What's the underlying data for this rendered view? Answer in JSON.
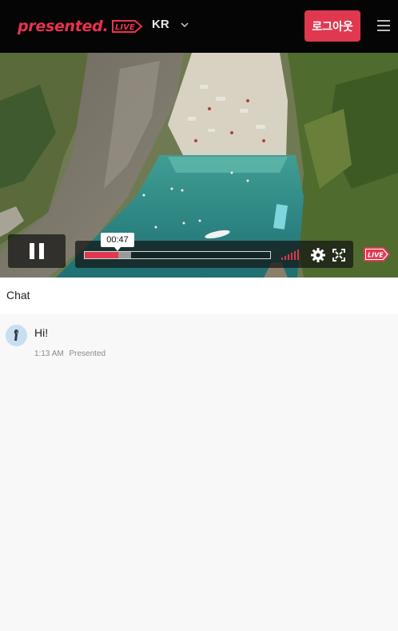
{
  "header": {
    "logo_text": "presented.",
    "logo_badge": "LIVE",
    "language": "KR",
    "logout_label": "로그아웃",
    "brand_color": "#e0384f"
  },
  "player": {
    "current_time": "00:47",
    "progress": 0.18,
    "buffered": 0.25,
    "state": "playing",
    "live_badge": "LIVE"
  },
  "chat": {
    "title": "Chat",
    "messages": [
      {
        "text": "Hi!",
        "time": "1:13 AM",
        "author": "Presented"
      }
    ]
  }
}
